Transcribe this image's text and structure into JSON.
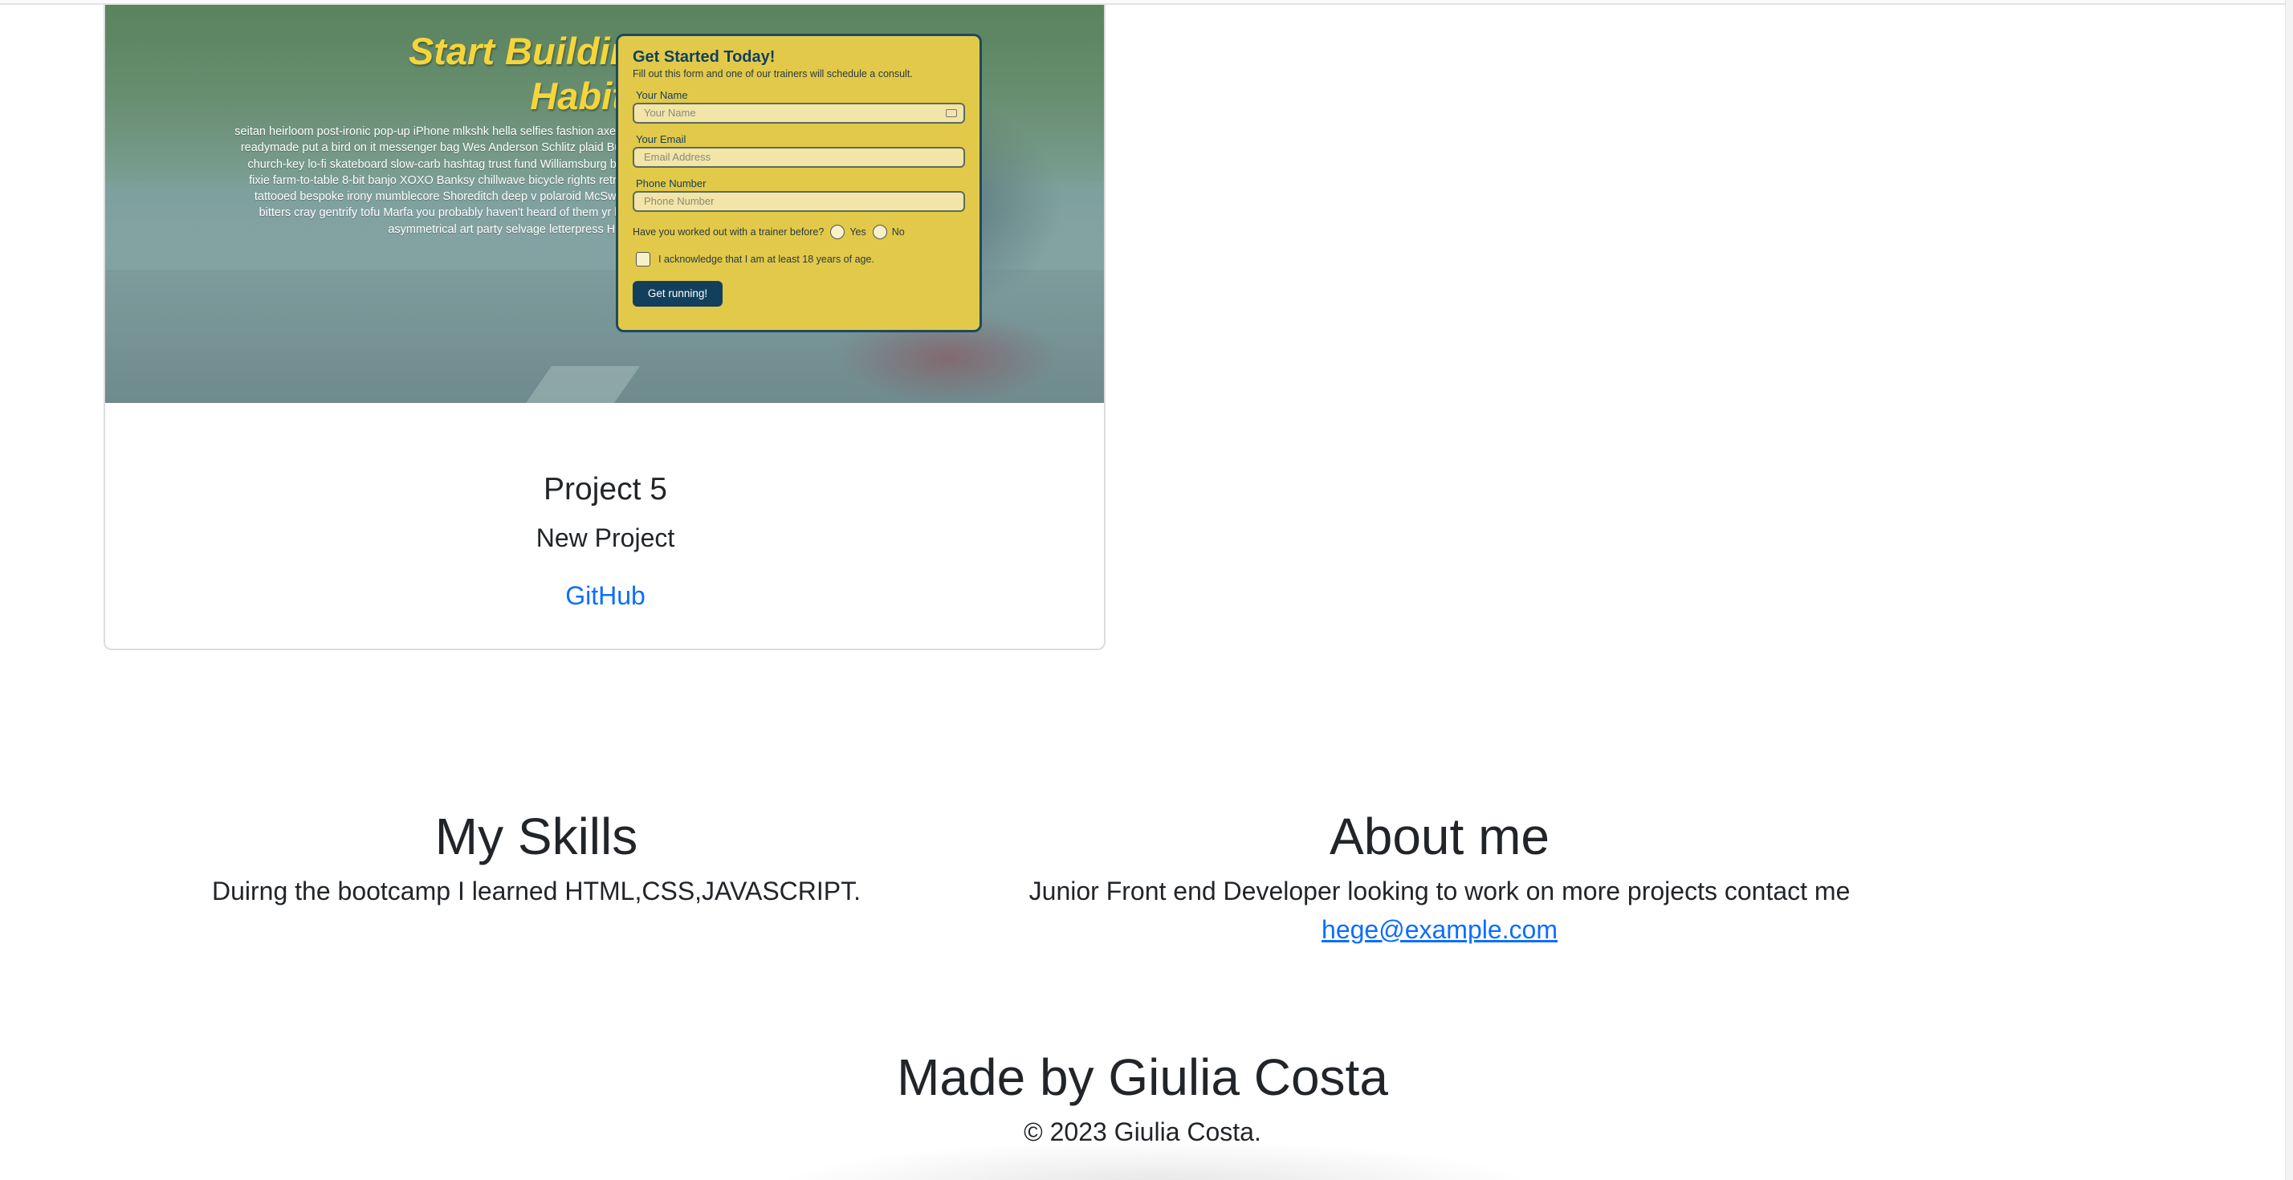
{
  "project_card": {
    "screenshot": {
      "hero_title": "Start Building Habits.",
      "hero_text": "seitan heirloom post-ironic pop-up iPhone mlkshk hella selfies fashion axe occupy readymade put a bird on it messenger bag Wes Anderson Schlitz plaid Bushwick church-key lo-fi skateboard slow-carb hashtag trust fund Williamsburg biodiesel fixie farm-to-table 8-bit banjo XOXO Banksy chillwave bicycle rights retro cliche tattooed bespoke irony mumblecore Shoreditch deep v polaroid McSweeney's bitters cray gentrify tofu Marfa you probably haven't heard of them yr banh mi asymmetrical art party selvage letterpress High Life.",
      "form": {
        "title": "Get Started Today!",
        "subtitle": "Fill out this form and one of our trainers will schedule a consult.",
        "name_label": "Your Name",
        "name_placeholder": "Your Name",
        "email_label": "Your Email",
        "email_placeholder": "Email Address",
        "phone_label": "Phone Number",
        "phone_placeholder": "Phone Number",
        "trainer_question": "Have you worked out with a trainer before?",
        "yes_label": "Yes",
        "no_label": "No",
        "acknowledge_label": "I acknowledge that I am at least 18 years of age.",
        "submit_label": "Get running!"
      }
    },
    "title": "Project 5",
    "subtitle": "New Project",
    "link_label": "GitHub"
  },
  "skills": {
    "heading": "My Skills",
    "text": "Duirng the bootcamp I learned HTML,CSS,JAVASCRIPT."
  },
  "about": {
    "heading": "About me",
    "text": "Junior Front end Developer looking to work on more projects contact me",
    "email": "hege@example.com"
  },
  "footer": {
    "heading": "Made by Giulia Costa",
    "copyright": "© 2023 Giulia Costa."
  },
  "colors": {
    "link": "#0d6efd",
    "text": "#212529",
    "hero_yellow": "#f5d63a",
    "form_bg": "#e2c94a",
    "form_navy": "#12405c"
  }
}
